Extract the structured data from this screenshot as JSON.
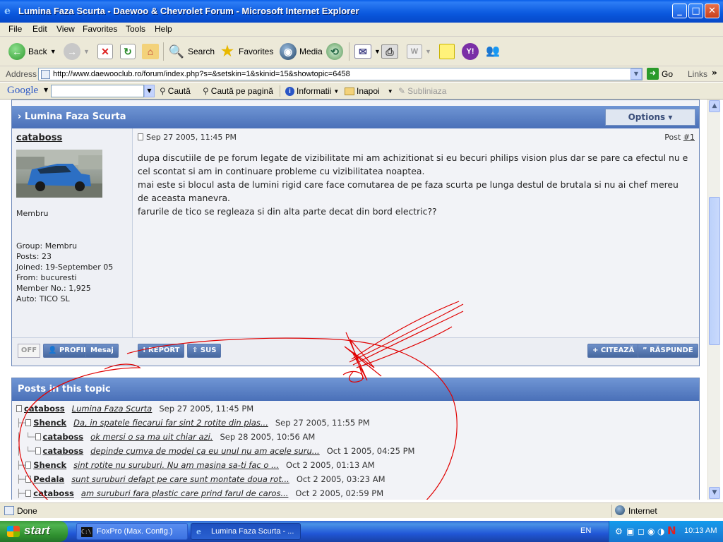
{
  "window": {
    "title": "Lumina Faza Scurta - Daewoo & Chevrolet Forum - Microsoft Internet Explorer",
    "buttons": {
      "minimize": "_",
      "maximize": "□",
      "close": "✕"
    }
  },
  "menu": [
    "File",
    "Edit",
    "View",
    "Favorites",
    "Tools",
    "Help"
  ],
  "toolbar": {
    "back": "Back",
    "search": "Search",
    "favorites": "Favorites",
    "media": "Media"
  },
  "address": {
    "label": "Address",
    "url": "http://www.daewooclub.ro/forum/index.php?s=&setskin=1&skinid=15&showtopic=6458",
    "go": "Go",
    "links": "Links"
  },
  "google": {
    "logo": "Google",
    "search_value": "",
    "cauta": "Caută",
    "cauta_pagina": "Caută pe pagină",
    "informatii": "Informatii",
    "inapoi": "Inapoi",
    "subliniaza": "Subliniaza"
  },
  "post": {
    "topic_title": "Lumina Faza Scurta",
    "options": "Options ▾",
    "author": "cataboss",
    "role": "Membru",
    "group": "Group: Membru",
    "posts": "Posts: 23",
    "joined": "Joined: 19-September 05",
    "from": "From: bucuresti",
    "member_no": "Member No.: 1,925",
    "auto": "Auto: TICO SL",
    "date": "Sep 27 2005, 11:45 PM",
    "post_label": "Post",
    "post_number": "#1",
    "paragraphs": [
      "dupa discutiile de pe forum legate de vizibilitate mi am achizitionat si eu becuri philips vision plus dar se pare ca efectul nu e cel scontat si am in continuare probleme cu vizibilitatea noaptea.",
      "mai este si blocul asta de lumini rigid care face comutarea de pe faza scurta pe lunga destul de brutala si nu ai chef mereu de aceasta manevra.",
      "farurile de tico se regleaza si din alta parte decat din bord electric??"
    ],
    "footer": {
      "off": "OFF",
      "profil": "PROFIL",
      "mesaj": "Mesaj",
      "report": "REPORT",
      "sus": "SUS",
      "citeaza": "CITEAZĂ",
      "raspunde": "RĂSPUNDE"
    }
  },
  "topic": {
    "title": "Posts in this topic",
    "rows": [
      {
        "tree": "",
        "user": "cataboss",
        "subject": "Lumina Faza Scurta",
        "date": "Sep 27 2005, 11:45 PM"
      },
      {
        "tree": "├─",
        "user": "Shenck",
        "subject": "Da, in spatele fiecarui far sint 2 rotite din plas...",
        "date": "Sep 27 2005, 11:55 PM"
      },
      {
        "tree": "│ └─",
        "user": "cataboss",
        "subject": "ok mersi o sa ma uit chiar azi.",
        "date": "Sep 28 2005, 10:56 AM"
      },
      {
        "tree": "│   └─",
        "user": "cataboss",
        "subject": "depinde cumva de model ca eu unul nu am acele suru...",
        "date": "Oct 1 2005, 04:25 PM"
      },
      {
        "tree": "├─",
        "user": "Shenck",
        "subject": "sint rotite nu suruburi. Nu am masina sa-ti fac o ...",
        "date": "Oct 2 2005, 01:13 AM"
      },
      {
        "tree": "├─",
        "user": "Pedala",
        "subject": "sunt suruburi defapt pe care sunt montate doua rot...",
        "date": "Oct 2 2005, 03:23 AM"
      },
      {
        "tree": "├─",
        "user": "cataboss",
        "subject": "am suruburi fara plastic care prind farul de caros...",
        "date": "Oct 2 2005, 02:59 PM"
      }
    ]
  },
  "status": {
    "text": "Done",
    "zone": "Internet"
  },
  "taskbar": {
    "start": "start",
    "tasks": [
      "FoxPro (Max. Config.)",
      "Lumina Faza Scurta - ..."
    ],
    "lang": "EN",
    "clock": "10:13 AM"
  }
}
